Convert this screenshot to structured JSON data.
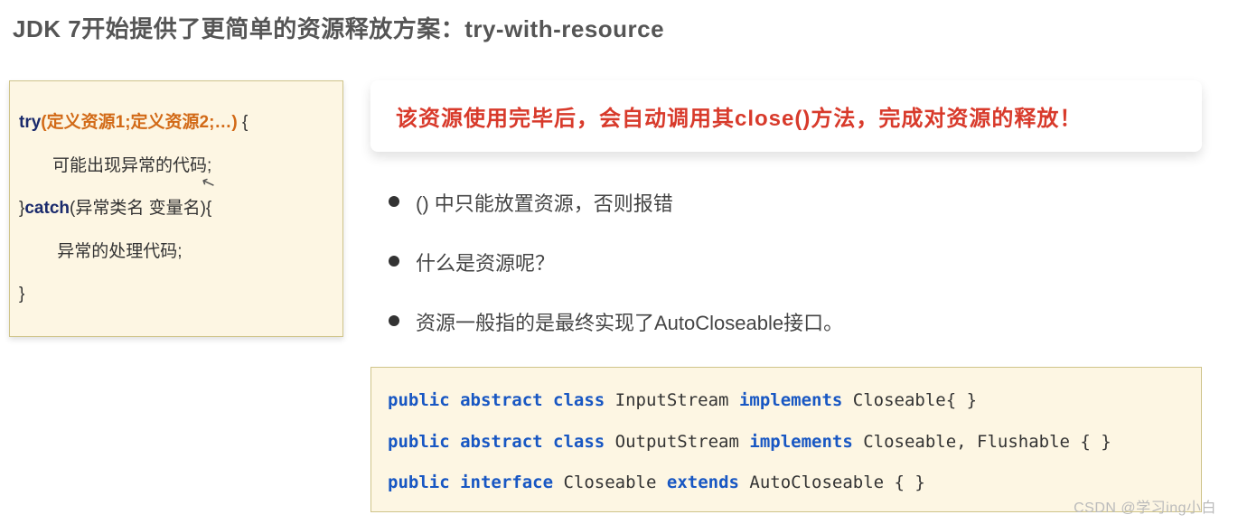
{
  "title": "JDK 7开始提供了更简单的资源释放方案：try-with-resource",
  "leftCode": {
    "l1_pre": "try",
    "l1_paren": "(定义资源1;定义资源2;…) ",
    "l1_post": "{",
    "l2": "       可能出现异常的代码;",
    "l3_pre": "}",
    "l3_kw": "catch",
    "l3_post": "(异常类名 变量名){",
    "l4": "        异常的处理代码;",
    "l5": "}"
  },
  "callout": "该资源使用完毕后，会自动调用其close()方法，完成对资源的释放！",
  "bullets": [
    "() 中只能放置资源，否则报错",
    "什么是资源呢？",
    "资源一般指的是最终实现了AutoCloseable接口。"
  ],
  "bottomCode": {
    "r1": {
      "k1": "public abstract class",
      "t1": " InputStream ",
      "k2": "implements",
      "t2": " Closeable{ }"
    },
    "r2": {
      "k1": "public abstract class",
      "t1": " OutputStream ",
      "k2": "implements",
      "t2": " Closeable, Flushable { }"
    },
    "r3": {
      "k1": "public interface",
      "t1": " Closeable ",
      "k2": "extends",
      "t2": " AutoCloseable { }"
    }
  },
  "watermark": "CSDN @学习ing小白"
}
